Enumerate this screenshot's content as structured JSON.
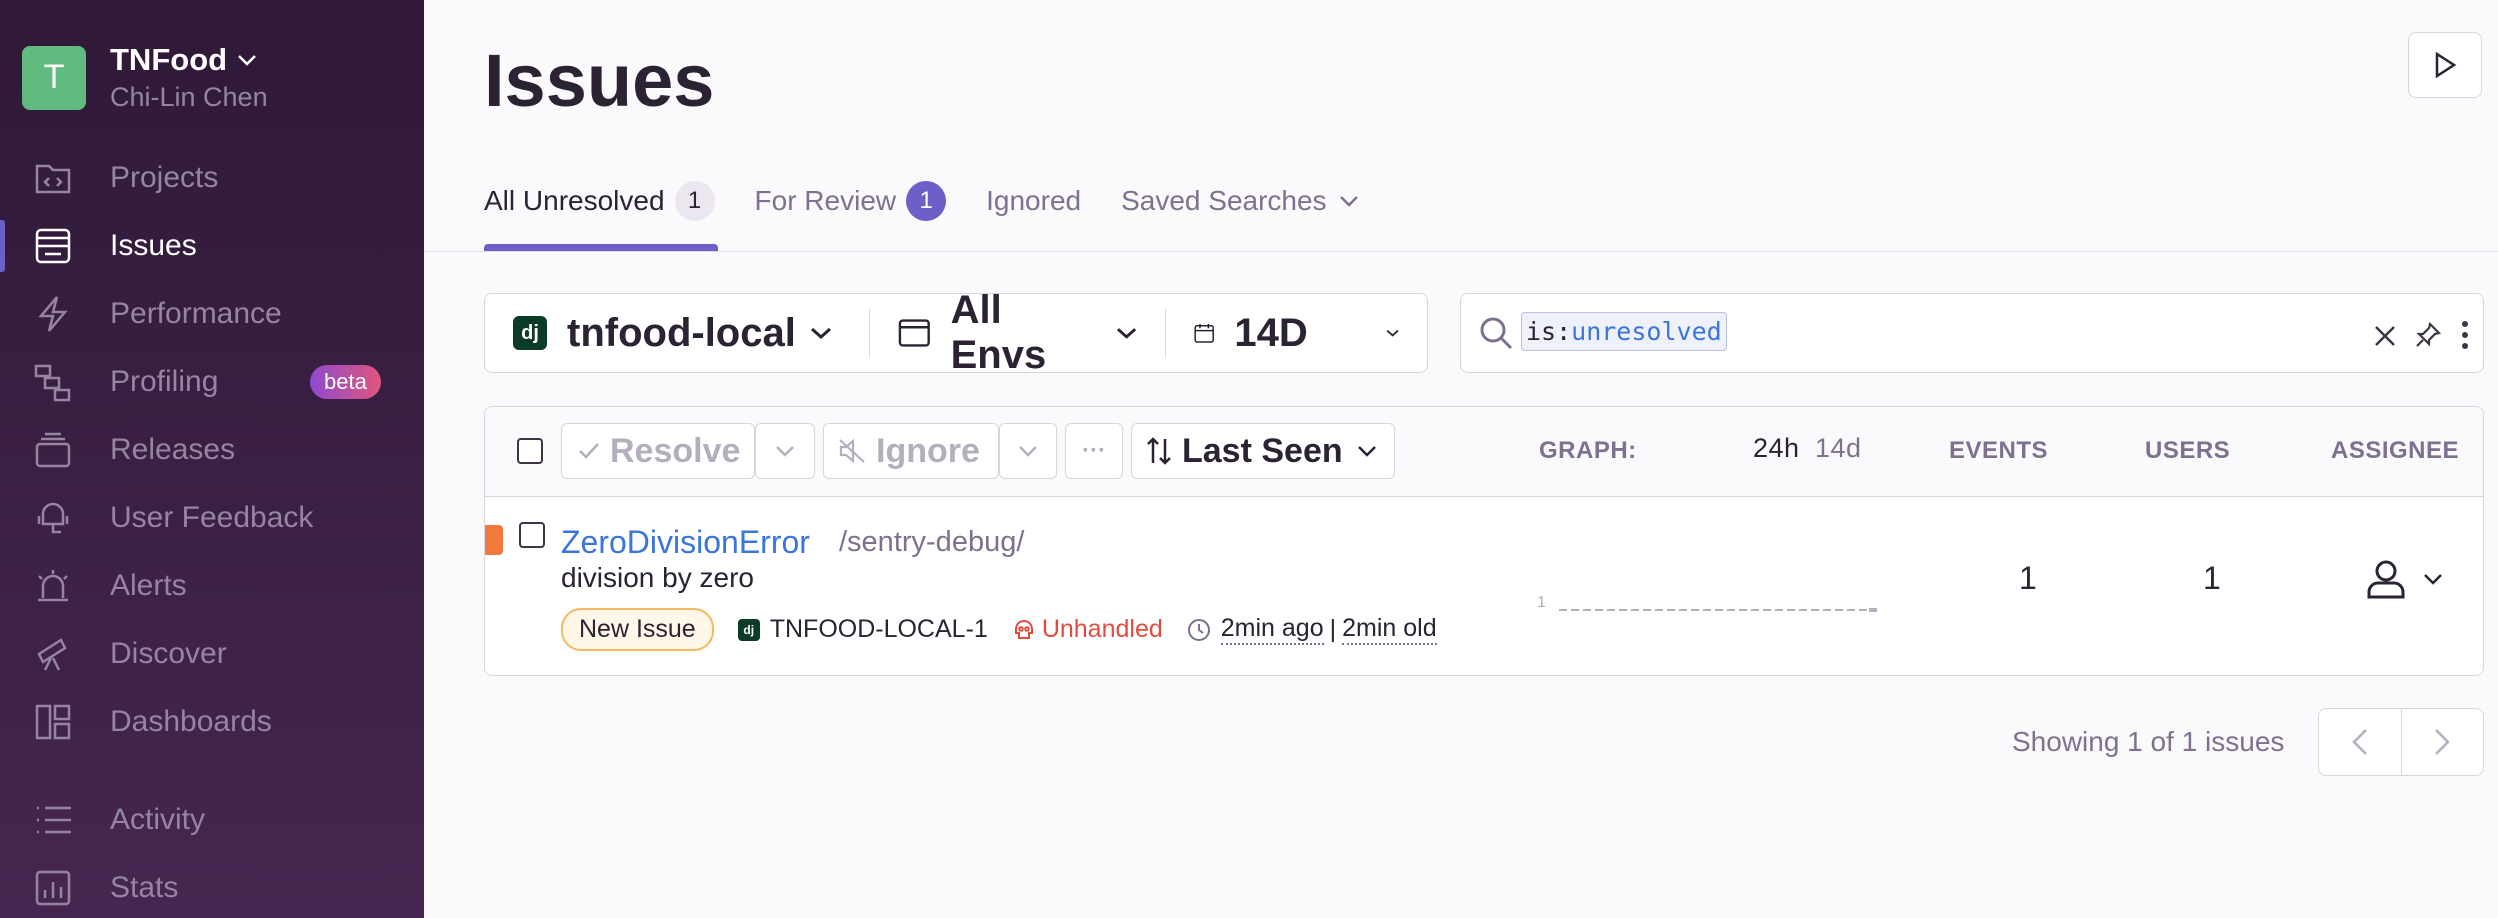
{
  "org": {
    "initial": "T",
    "name": "TNFood",
    "user": "Chi-Lin Chen"
  },
  "nav": [
    {
      "label": "Projects",
      "icon": "projects-icon"
    },
    {
      "label": "Issues",
      "icon": "issues-icon",
      "active": true
    },
    {
      "label": "Performance",
      "icon": "lightning-icon"
    },
    {
      "label": "Profiling",
      "icon": "profiling-icon",
      "badge": "beta"
    },
    {
      "label": "Releases",
      "icon": "releases-icon"
    },
    {
      "label": "User Feedback",
      "icon": "megaphone-icon"
    },
    {
      "label": "Alerts",
      "icon": "siren-icon"
    },
    {
      "label": "Discover",
      "icon": "telescope-icon"
    },
    {
      "label": "Dashboards",
      "icon": "dashboards-icon"
    },
    {
      "label": "Activity",
      "icon": "list-icon"
    },
    {
      "label": "Stats",
      "icon": "stats-icon"
    }
  ],
  "page": {
    "title": "Issues"
  },
  "tabs": [
    {
      "label": "All Unresolved",
      "count": "1"
    },
    {
      "label": "For Review",
      "count": "1"
    },
    {
      "label": "Ignored"
    },
    {
      "label": "Saved Searches"
    }
  ],
  "filters": {
    "project": "tnfood-local",
    "environment": "All Envs",
    "period": "14D"
  },
  "search": {
    "key": "is:",
    "value": "unresolved"
  },
  "toolbar": {
    "resolve": "Resolve",
    "ignore": "Ignore",
    "more": "···",
    "sort": "Last Seen"
  },
  "columns": {
    "graph": "GRAPH:",
    "graph_24h": "24h",
    "graph_14d": "14d",
    "events": "EVENTS",
    "users": "USERS",
    "assignee": "ASSIGNEE"
  },
  "issue": {
    "title": "ZeroDivisionError",
    "location": "/sentry-debug/",
    "message": "division by zero",
    "badge": "New Issue",
    "short_id": "TNFOOD-LOCAL-1",
    "handled": "Unhandled",
    "last_seen": "2min ago",
    "first_seen": "2min old",
    "graph_max": "1",
    "events": "1",
    "users": "1"
  },
  "pagination": {
    "text": "Showing 1 of 1 issues"
  },
  "colors": {
    "accent": "#6c5fc7",
    "link": "#3c74dd",
    "priority": "#f2783b",
    "error": "#e34b3f"
  }
}
